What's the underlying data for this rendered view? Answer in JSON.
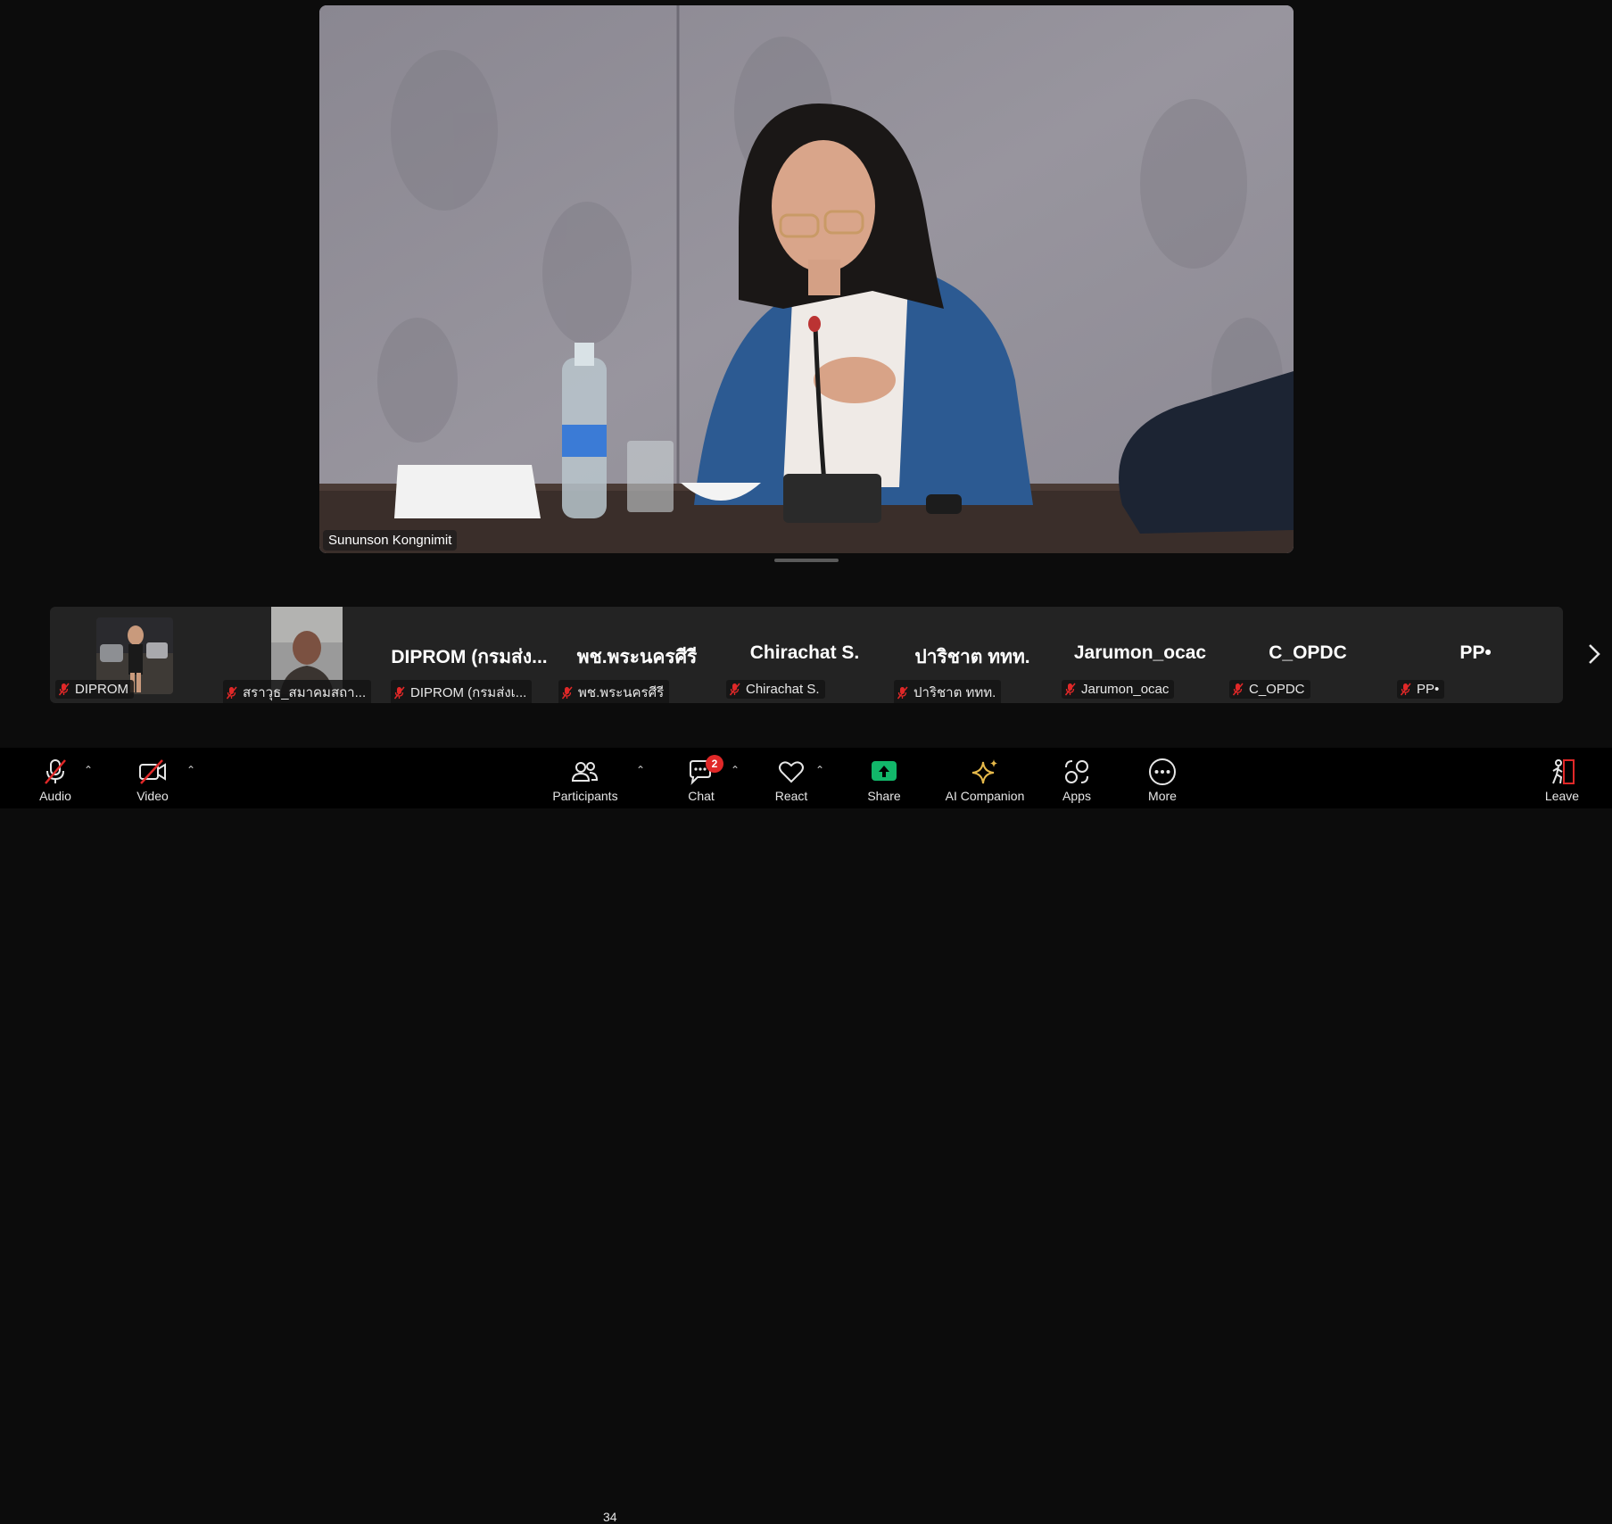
{
  "main_video": {
    "speaker_name": "Sununson Kongnimit"
  },
  "participants": [
    {
      "name": "DIPROM",
      "display": "",
      "has_video": true
    },
    {
      "name": "สราวุธ_สมาคมสถา...",
      "display": "",
      "has_video": true
    },
    {
      "name": "DIPROM (กรมส่งเ...",
      "display": "DIPROM (กรมส่ง...",
      "has_video": false
    },
    {
      "name": "พช.พระนครศีรี",
      "display": "พช.พระนครศีรี",
      "has_video": false
    },
    {
      "name": "Chirachat S.",
      "display": "Chirachat S.",
      "has_video": false
    },
    {
      "name": "ปาริชาต ททท.",
      "display": "ปาริชาต ททท.",
      "has_video": false
    },
    {
      "name": "Jarumon_ocac",
      "display": "Jarumon_ocac",
      "has_video": false
    },
    {
      "name": "C_OPDC",
      "display": "C_OPDC",
      "has_video": false
    },
    {
      "name": "PP•",
      "display": "PP•",
      "has_video": false
    }
  ],
  "toolbar": {
    "audio": "Audio",
    "video": "Video",
    "participants": "Participants",
    "participants_count": "34",
    "chat": "Chat",
    "chat_badge": "2",
    "react": "React",
    "share": "Share",
    "ai_companion": "AI Companion",
    "apps": "Apps",
    "more": "More",
    "leave": "Leave"
  },
  "colors": {
    "background": "#0c0c0c",
    "strip": "#232323",
    "muted_red": "#e02828",
    "share_green": "#12b76a",
    "ai_gold": "#e6b94a"
  }
}
